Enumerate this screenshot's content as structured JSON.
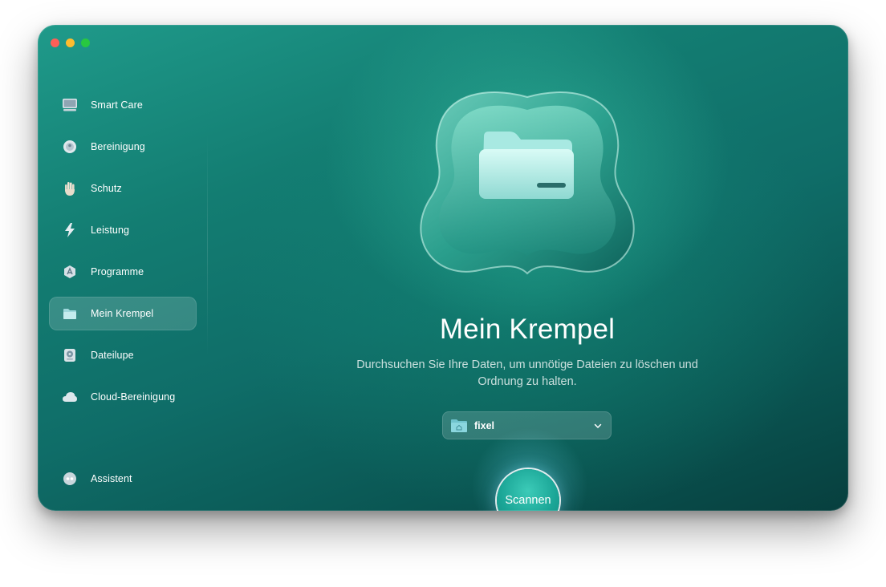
{
  "window": {
    "controls": [
      "close",
      "minimize",
      "maximize"
    ]
  },
  "sidebar": {
    "items": [
      {
        "label": "Smart Care",
        "icon": "smart-care-icon"
      },
      {
        "label": "Bereinigung",
        "icon": "cleanup-icon"
      },
      {
        "label": "Schutz",
        "icon": "hand-icon"
      },
      {
        "label": "Leistung",
        "icon": "lightning-icon"
      },
      {
        "label": "Programme",
        "icon": "apps-icon"
      },
      {
        "label": "Mein Krempel",
        "icon": "folder-icon",
        "active": true
      },
      {
        "label": "Dateilupe",
        "icon": "drive-icon"
      },
      {
        "label": "Cloud-Bereinigung",
        "icon": "cloud-icon"
      }
    ],
    "assistant": {
      "label": "Assistent",
      "icon": "assistant-icon"
    }
  },
  "main": {
    "title": "Mein Krempel",
    "subtitle": "Durchsuchen Sie Ihre Daten, um unnötige Dateien zu löschen und Ordnung zu halten.",
    "folder_select": {
      "value": "fixel",
      "icon": "home-folder-icon"
    },
    "scan_button": "Scannen"
  },
  "colors": {
    "accent": "#1aa596",
    "background_top": "#1f9a8a",
    "background_bottom": "#073f3e"
  }
}
